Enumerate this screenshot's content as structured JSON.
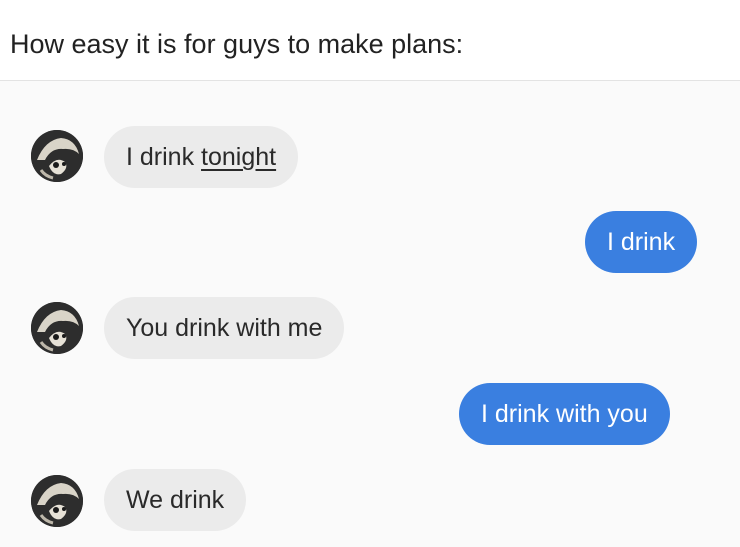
{
  "caption": {
    "text": "How easy it is for guys to make plans:"
  },
  "messages": [
    {
      "sender": "them",
      "parts": [
        "I drink ",
        "tonight"
      ],
      "underlined_part": "tonight"
    },
    {
      "sender": "me",
      "text": "I drink"
    },
    {
      "sender": "them",
      "text": "You drink with me"
    },
    {
      "sender": "me",
      "text": "I drink with you"
    },
    {
      "sender": "them",
      "text": "We drink"
    }
  ],
  "colors": {
    "incoming_bubble": "#ebebeb",
    "outgoing_bubble": "#3a7fe0",
    "incoming_text": "#2a2a2a",
    "outgoing_text": "#ffffff",
    "background": "#fafafa"
  },
  "icons": {
    "avatar": "avatar-icon"
  }
}
